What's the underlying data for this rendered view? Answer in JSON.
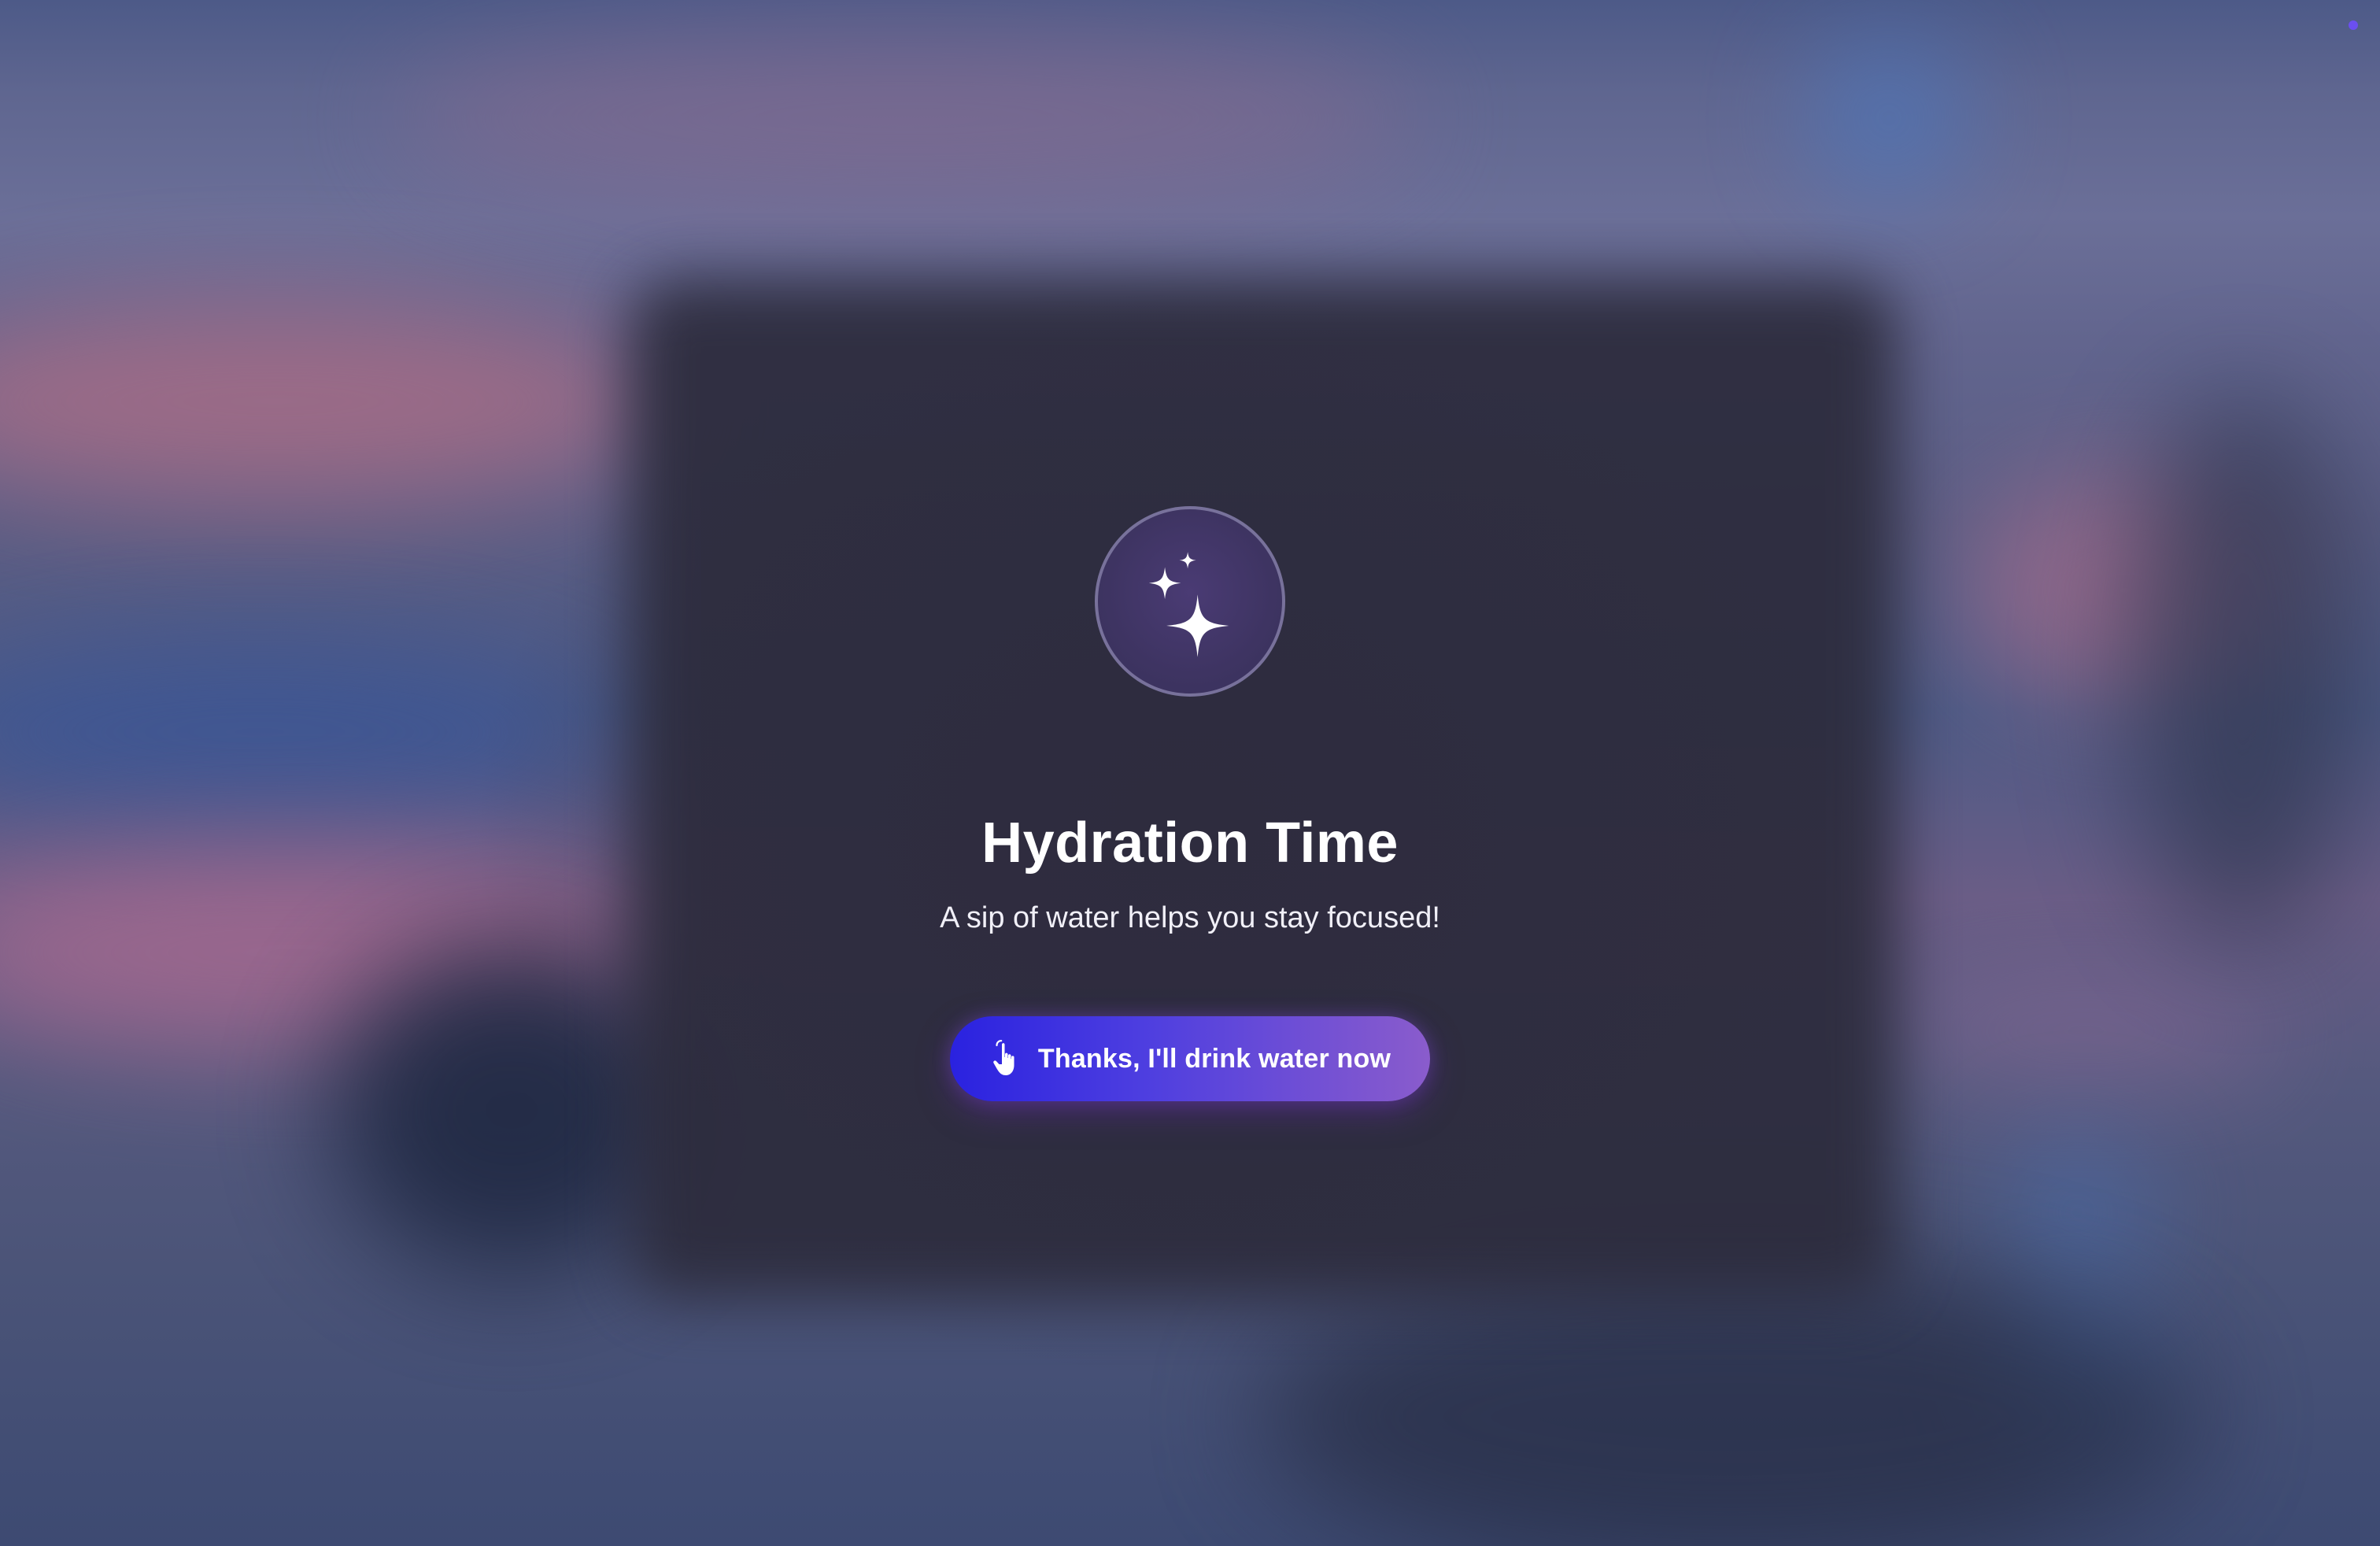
{
  "reminder": {
    "icon": "sparkles-icon",
    "title": "Hydration Time",
    "message": "A sip of water helps you stay focused!",
    "action": {
      "label": "Thanks, I'll drink water now",
      "icon": "hand-pointer-icon"
    }
  },
  "colors": {
    "button_gradient_start": "#2a22e0",
    "button_gradient_end": "#8a5ccc",
    "icon_ring_fill": "#3e3462",
    "indicator": "#6b4ff0"
  }
}
